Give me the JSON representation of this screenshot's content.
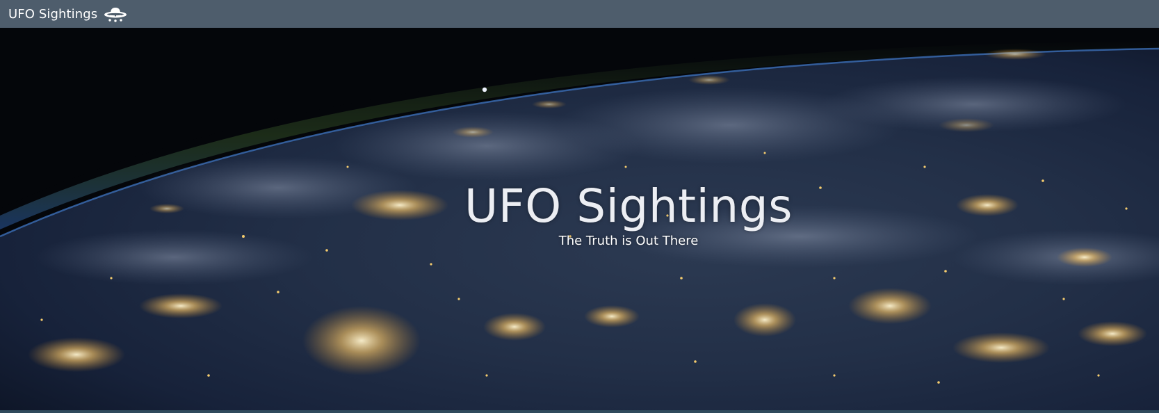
{
  "navbar": {
    "brand_text": "UFO Sightings",
    "brand_icon": "ufo-icon",
    "background": "#4e5d6c"
  },
  "hero": {
    "title": "UFO Sightings",
    "subtitle": "The Truth is Out There",
    "background_image": "earth-at-night-from-space"
  }
}
